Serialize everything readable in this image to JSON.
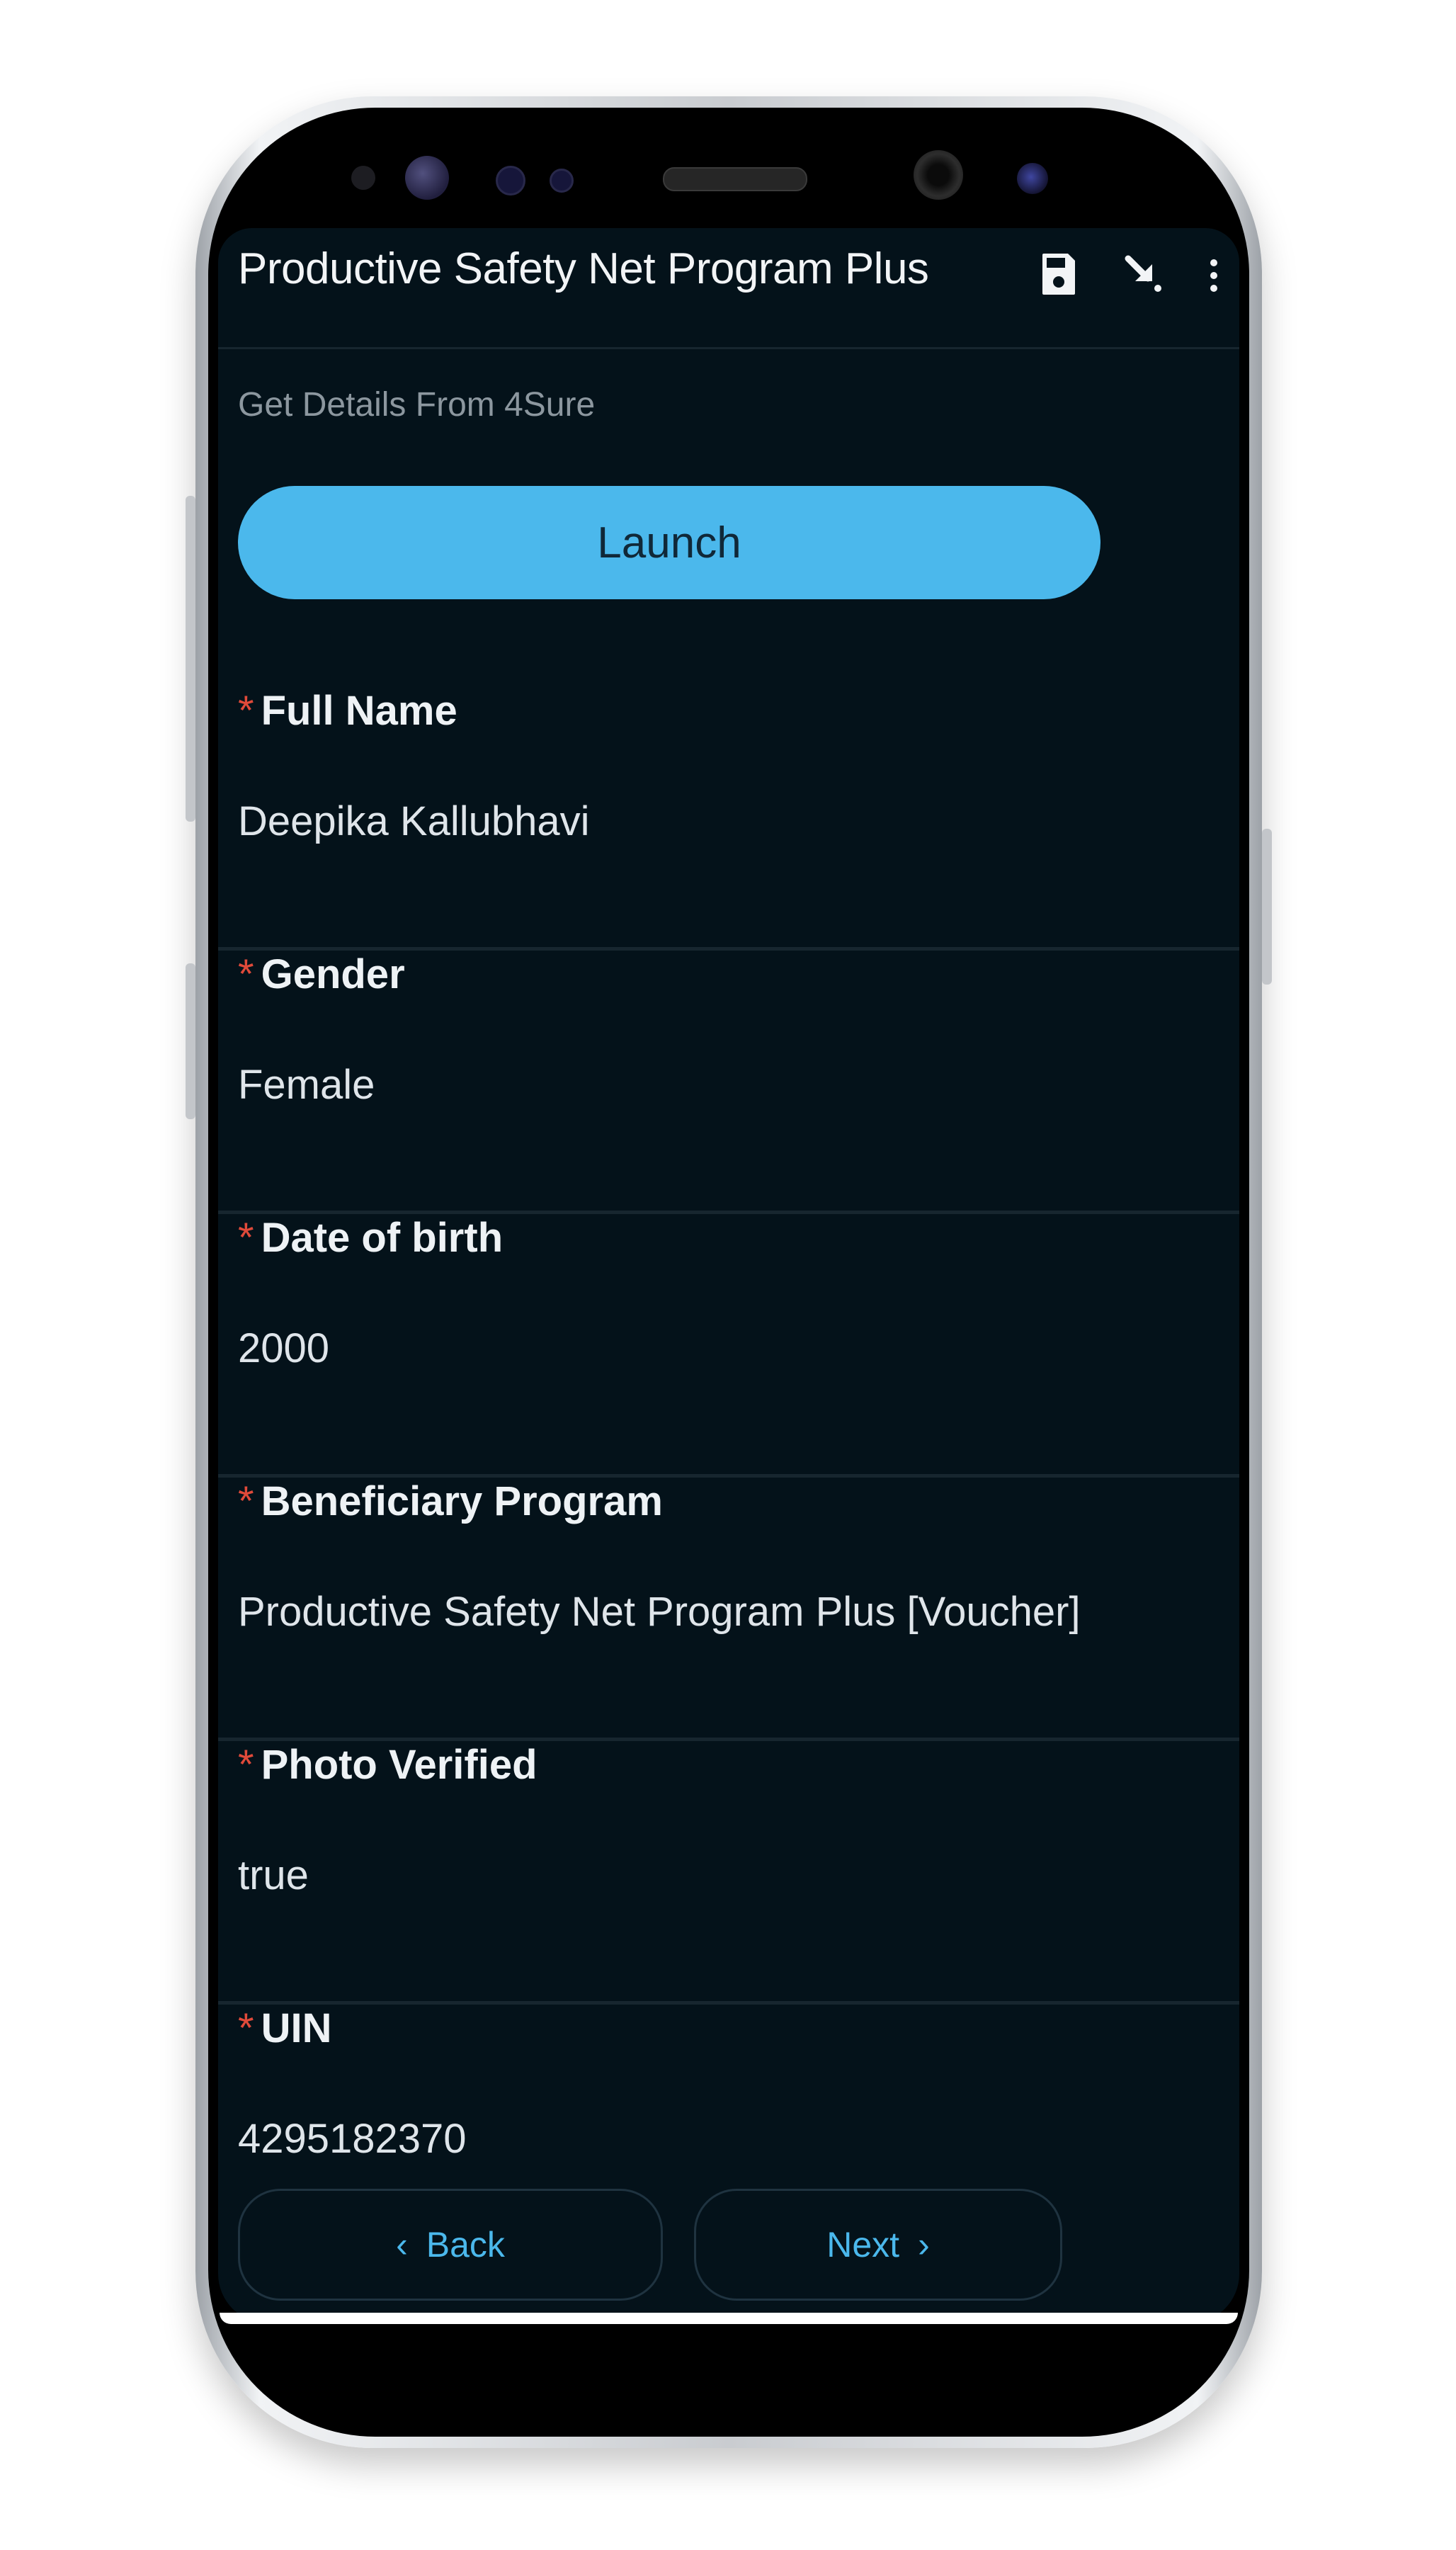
{
  "app": {
    "title": "Productive Safety Net Program Plus",
    "icons": {
      "save": "save-icon",
      "sync": "download-arrow-icon",
      "more": "more-vert-icon"
    }
  },
  "section": {
    "label": "Get Details From 4Sure",
    "launch_label": "Launch"
  },
  "required_marker": "*",
  "fields": [
    {
      "label": "Full Name",
      "value": "Deepika Kallubhavi"
    },
    {
      "label": "Gender",
      "value": "Female"
    },
    {
      "label": "Date of birth",
      "value": "2000"
    },
    {
      "label": "Beneficiary Program",
      "value": "Productive Safety Net Program Plus [Voucher]"
    },
    {
      "label": "Photo Verified",
      "value": "true"
    },
    {
      "label": "UIN",
      "value": "4295182370"
    }
  ],
  "nav": {
    "back_label": "Back",
    "next_label": "Next",
    "back_chevron": "‹",
    "next_chevron": "›"
  },
  "colors": {
    "accent": "#4bb8ec",
    "background": "#04121a",
    "required": "#e04a3a"
  }
}
